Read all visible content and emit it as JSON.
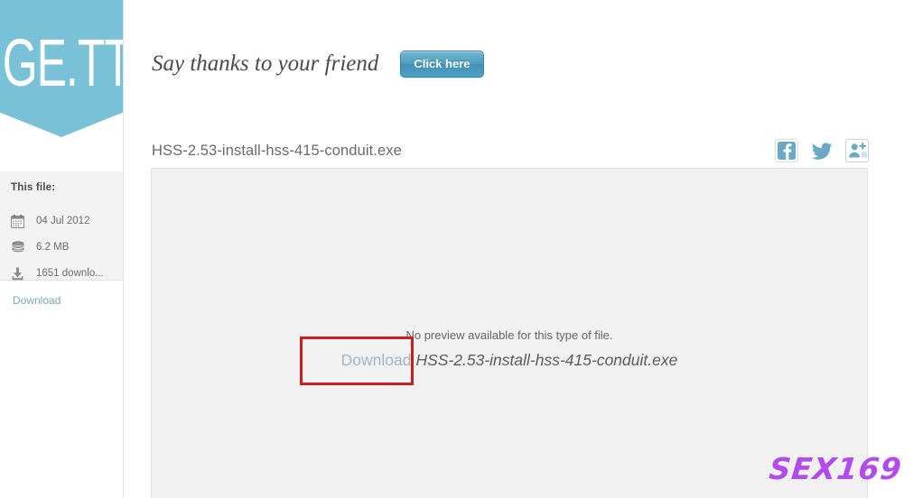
{
  "brand": {
    "logo_text": "GE.TT",
    "banner_color": "#79c1d6"
  },
  "sidebar": {
    "panel_title": "This file:",
    "rows": [
      {
        "icon": "calendar-icon",
        "label": "04 Jul 2012"
      },
      {
        "icon": "database-icon",
        "label": "6.2 MB"
      },
      {
        "icon": "download-icon",
        "label": "1651 downlo..."
      }
    ],
    "download_link": "Download"
  },
  "header": {
    "thanks_text": "Say thanks to your friend",
    "click_here_label": "Click here",
    "button_color": "#4e9dbe"
  },
  "file": {
    "name": "HSS-2.53-install-hss-415-conduit.exe"
  },
  "share": {
    "icons": [
      {
        "name": "facebook-icon",
        "label": "Facebook"
      },
      {
        "name": "twitter-icon",
        "label": "Twitter"
      },
      {
        "name": "google-plus-icon",
        "label": "Google+"
      }
    ]
  },
  "preview": {
    "no_preview_text": "No preview available for this type of file.",
    "download_link": "Download",
    "file_name": "HSS-2.53-install-hss-415-conduit.exe"
  },
  "annotation": {
    "color": "#cc1f1f",
    "target": "preview-download-link"
  },
  "watermark": {
    "text": "SEX169",
    "color": "#b24bef"
  }
}
